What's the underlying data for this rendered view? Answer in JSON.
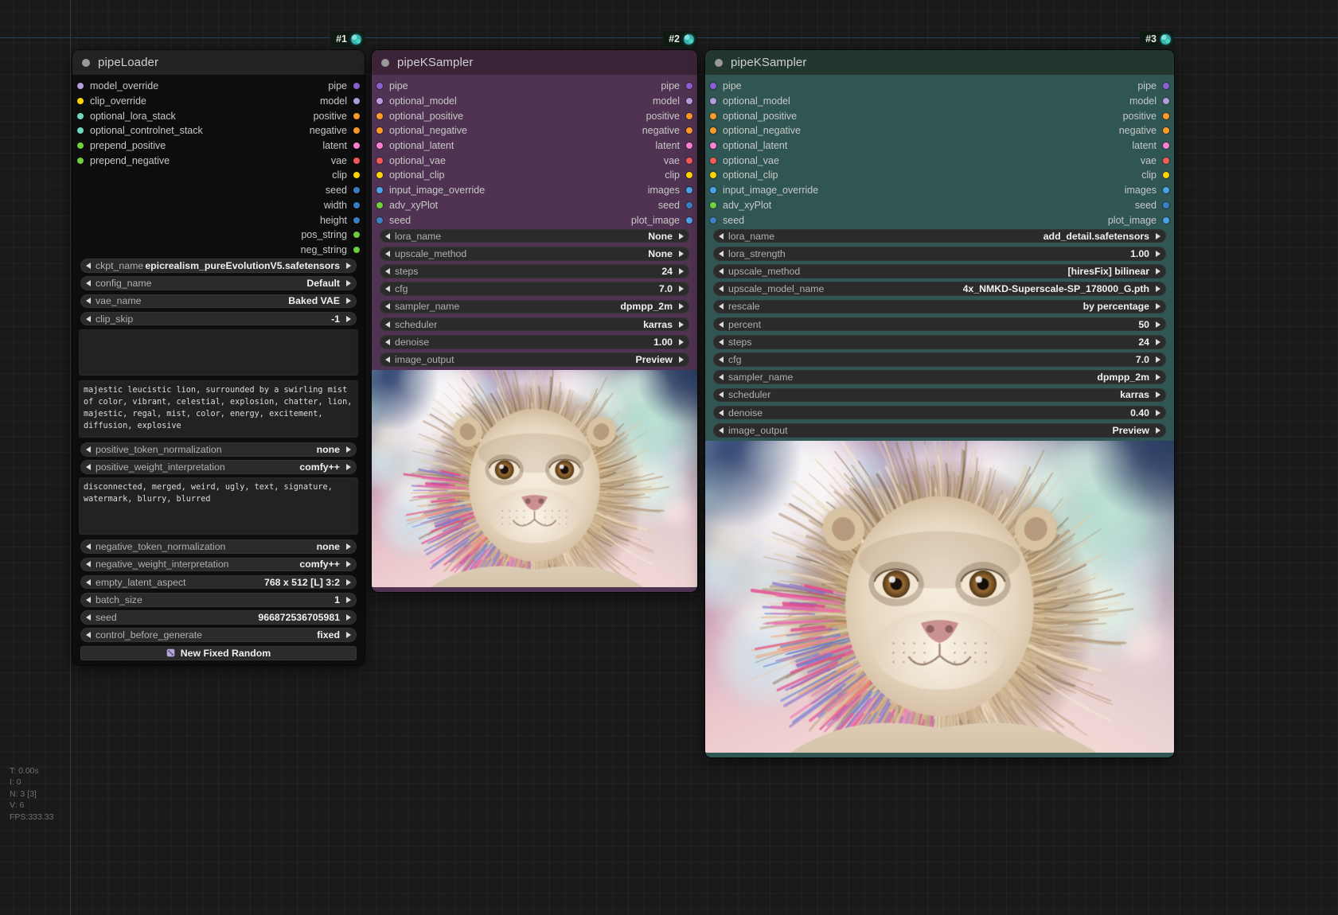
{
  "canvas": {
    "stats": [
      "T: 0.00s",
      "I: 0",
      "N: 3 [3]",
      "V: 6",
      "FPS:333.33"
    ]
  },
  "nodes": [
    {
      "badge": "#1",
      "title": "pipeLoader",
      "header_color": "#232323",
      "body_color": "#0d0d0d",
      "inputs": [
        {
          "name": "model_override",
          "color": "#b39ddb"
        },
        {
          "name": "clip_override",
          "color": "#ffd500"
        },
        {
          "name": "optional_lora_stack",
          "color": "#6fd6c0"
        },
        {
          "name": "optional_controlnet_stack",
          "color": "#6fd6c0"
        },
        {
          "name": "prepend_positive",
          "color": "#6fd13c"
        },
        {
          "name": "prepend_negative",
          "color": "#6fd13c"
        }
      ],
      "outputs": [
        {
          "name": "pipe",
          "color": "#8b5fd0"
        },
        {
          "name": "model",
          "color": "#b39ddb"
        },
        {
          "name": "positive",
          "color": "#ff9a26"
        },
        {
          "name": "negative",
          "color": "#ff9a26"
        },
        {
          "name": "latent",
          "color": "#ff7fd0"
        },
        {
          "name": "vae",
          "color": "#f55a55"
        },
        {
          "name": "clip",
          "color": "#ffd500"
        },
        {
          "name": "seed",
          "color": "#3b7fc4"
        },
        {
          "name": "width",
          "color": "#3b7fc4"
        },
        {
          "name": "height",
          "color": "#3b7fc4"
        },
        {
          "name": "pos_string",
          "color": "#6fd13c"
        },
        {
          "name": "neg_string",
          "color": "#6fd13c"
        }
      ],
      "widgets_top": [
        {
          "name": "ckpt_name",
          "value": "epicrealism_pureEvolutionV5.safetensors"
        },
        {
          "name": "config_name",
          "value": "Default"
        },
        {
          "name": "vae_name",
          "value": "Baked VAE"
        },
        {
          "name": "clip_skip",
          "value": "-1"
        }
      ],
      "blank_box": "",
      "positive_prompt": "majestic leucistic lion, surrounded by a swirling mist of color, vibrant, celestial, explosion, chatter, lion, majestic, regal, mist, color, energy, excitement, diffusion, explosive",
      "widgets_mid": [
        {
          "name": "positive_token_normalization",
          "value": "none"
        },
        {
          "name": "positive_weight_interpretation",
          "value": "comfy++"
        }
      ],
      "negative_prompt": "disconnected, merged, weird, ugly, text, signature, watermark, blurry, blurred",
      "widgets_bottom": [
        {
          "name": "negative_token_normalization",
          "value": "none"
        },
        {
          "name": "negative_weight_interpretation",
          "value": "comfy++"
        },
        {
          "name": "empty_latent_aspect",
          "value": "768 x 512 [L] 3:2"
        },
        {
          "name": "batch_size",
          "value": "1"
        },
        {
          "name": "seed",
          "value": "966872536705981"
        },
        {
          "name": "control_before_generate",
          "value": "fixed"
        }
      ],
      "button": {
        "label": "New Fixed Random",
        "icon": "dice-icon"
      }
    },
    {
      "badge": "#2",
      "title": "pipeKSampler",
      "header_color": "#3c2438",
      "body_color": "#503352",
      "inputs": [
        {
          "name": "pipe",
          "color": "#8b5fd0"
        },
        {
          "name": "optional_model",
          "color": "#b39ddb"
        },
        {
          "name": "optional_positive",
          "color": "#ff9a26"
        },
        {
          "name": "optional_negative",
          "color": "#ff9a26"
        },
        {
          "name": "optional_latent",
          "color": "#ff7fd0"
        },
        {
          "name": "optional_vae",
          "color": "#f55a55"
        },
        {
          "name": "optional_clip",
          "color": "#ffd500"
        },
        {
          "name": "input_image_override",
          "color": "#4aa3e8"
        },
        {
          "name": "adv_xyPlot",
          "color": "#6fd13c"
        },
        {
          "name": "seed",
          "color": "#3b7fc4"
        }
      ],
      "outputs": [
        {
          "name": "pipe",
          "color": "#8b5fd0"
        },
        {
          "name": "model",
          "color": "#b39ddb"
        },
        {
          "name": "positive",
          "color": "#ff9a26"
        },
        {
          "name": "negative",
          "color": "#ff9a26"
        },
        {
          "name": "latent",
          "color": "#ff7fd0"
        },
        {
          "name": "vae",
          "color": "#f55a55"
        },
        {
          "name": "clip",
          "color": "#ffd500"
        },
        {
          "name": "images",
          "color": "#4aa3e8"
        },
        {
          "name": "seed",
          "color": "#3b7fc4"
        },
        {
          "name": "plot_image",
          "color": "#4aa3e8"
        }
      ],
      "widgets": [
        {
          "name": "lora_name",
          "value": "None"
        },
        {
          "name": "upscale_method",
          "value": "None"
        },
        {
          "name": "steps",
          "value": "24"
        },
        {
          "name": "cfg",
          "value": "7.0"
        },
        {
          "name": "sampler_name",
          "value": "dpmpp_2m"
        },
        {
          "name": "scheduler",
          "value": "karras"
        },
        {
          "name": "denoise",
          "value": "1.00"
        },
        {
          "name": "image_output",
          "value": "Preview"
        }
      ],
      "preview": {
        "name": "lion-preview-image",
        "alt": "majestic leucistic lion in colorful mist"
      }
    },
    {
      "badge": "#3",
      "title": "pipeKSampler",
      "header_color": "#22382f",
      "body_color": "#2f5653",
      "inputs": [
        {
          "name": "pipe",
          "color": "#8b5fd0"
        },
        {
          "name": "optional_model",
          "color": "#b39ddb"
        },
        {
          "name": "optional_positive",
          "color": "#ff9a26"
        },
        {
          "name": "optional_negative",
          "color": "#ff9a26"
        },
        {
          "name": "optional_latent",
          "color": "#ff7fd0"
        },
        {
          "name": "optional_vae",
          "color": "#f55a55"
        },
        {
          "name": "optional_clip",
          "color": "#ffd500"
        },
        {
          "name": "input_image_override",
          "color": "#4aa3e8"
        },
        {
          "name": "adv_xyPlot",
          "color": "#6fd13c"
        },
        {
          "name": "seed",
          "color": "#3b7fc4"
        }
      ],
      "outputs": [
        {
          "name": "pipe",
          "color": "#8b5fd0"
        },
        {
          "name": "model",
          "color": "#b39ddb"
        },
        {
          "name": "positive",
          "color": "#ff9a26"
        },
        {
          "name": "negative",
          "color": "#ff9a26"
        },
        {
          "name": "latent",
          "color": "#ff7fd0"
        },
        {
          "name": "vae",
          "color": "#f55a55"
        },
        {
          "name": "clip",
          "color": "#ffd500"
        },
        {
          "name": "images",
          "color": "#4aa3e8"
        },
        {
          "name": "seed",
          "color": "#3b7fc4"
        },
        {
          "name": "plot_image",
          "color": "#4aa3e8"
        }
      ],
      "widgets": [
        {
          "name": "lora_name",
          "value": "add_detail.safetensors"
        },
        {
          "name": "lora_strength",
          "value": "1.00"
        },
        {
          "name": "upscale_method",
          "value": "[hiresFix] bilinear"
        },
        {
          "name": "upscale_model_name",
          "value": "4x_NMKD-Superscale-SP_178000_G.pth"
        },
        {
          "name": "rescale",
          "value": "by percentage"
        },
        {
          "name": "percent",
          "value": "50"
        },
        {
          "name": "steps",
          "value": "24"
        },
        {
          "name": "cfg",
          "value": "7.0"
        },
        {
          "name": "sampler_name",
          "value": "dpmpp_2m"
        },
        {
          "name": "scheduler",
          "value": "karras"
        },
        {
          "name": "denoise",
          "value": "0.40"
        },
        {
          "name": "image_output",
          "value": "Preview"
        }
      ],
      "preview": {
        "name": "lion-preview-image",
        "alt": "upscaled majestic leucistic lion in colorful mist"
      }
    }
  ]
}
